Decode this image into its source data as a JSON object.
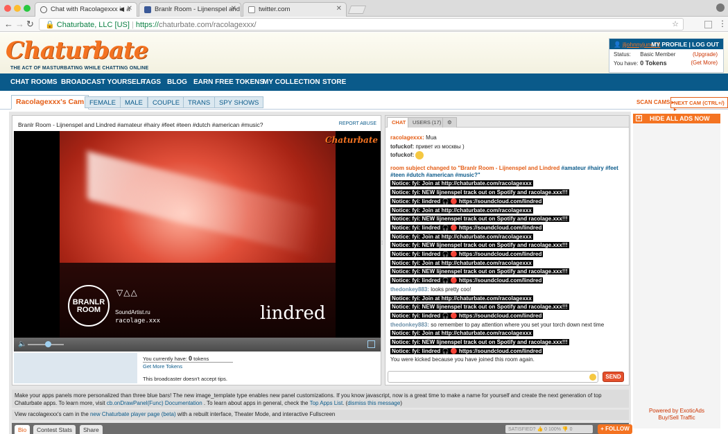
{
  "browser": {
    "tabs": [
      {
        "title": "Chat with Racolagexxx in a"
      },
      {
        "title": "Branlr Room - Lijnenspel and L"
      },
      {
        "title": "twitter.com"
      }
    ],
    "url_secure_label": "Chaturbate, LLC [US]",
    "url_https": "https://",
    "url_rest": "chaturbate.com/racolagexxx/"
  },
  "header": {
    "logo": "Chaturbate",
    "tagline": "THE ACT OF MASTURBATING WHILE CHATTING ONLINE",
    "user": {
      "username": "jljohnnyjune78",
      "my_profile": "MY PROFILE",
      "log_out": "LOG OUT",
      "status_label": "Status:",
      "status_value": "Basic Member",
      "upgrade": "(Upgrade)",
      "have_label": "You have:",
      "have_value": "0 Tokens",
      "get_more": "(Get More)"
    }
  },
  "nav": [
    "CHAT ROOMS",
    "BROADCAST YOURSELF",
    "TAGS",
    "BLOG",
    "EARN FREE TOKENS",
    "MY COLLECTION",
    "STORE"
  ],
  "subnav": {
    "tabs": [
      "Racolagexxx's Cam",
      "FEMALE",
      "MALE",
      "COUPLE",
      "TRANS",
      "SPY SHOWS"
    ],
    "scan_cams": "SCAN CAMS",
    "next_cam": "NEXT CAM (CTRL+/)"
  },
  "video": {
    "title": "Branlr Room - Lijnenspel and Lindred #amateur #hairy #feet #teen #dutch #american #music?",
    "report_abuse": "REPORT ABUSE",
    "watermark": "Chaturbate",
    "overlay_branlr": "BRANLR ROOM",
    "overlay_triangles": "▽△△",
    "overlay_soundartist": "SoundArtist.ru",
    "overlay_racolage": "racolage.xxx",
    "overlay_lindred": "lindred",
    "volume_level": 0.55
  },
  "tips": {
    "you_have_prefix": "You currently have:",
    "tokens_count": "0",
    "tokens_suffix": "tokens",
    "get_more_tokens": "Get More Tokens",
    "no_tips": "This broadcaster doesn't accept tips."
  },
  "chat": {
    "tabs": [
      "CHAT",
      "USERS (17)"
    ],
    "send": "SEND",
    "messages": [
      {
        "type": "user",
        "user": "racolagexxx:",
        "text": "Mua"
      },
      {
        "type": "user2",
        "user": "tofuckof:",
        "text": "привет из москвы )"
      },
      {
        "type": "user2emoji",
        "user": "tofuckof:",
        "text": ""
      },
      {
        "type": "subject",
        "text": "room subject changed to \"Branlr Room - Lijnenspel and Lindred",
        "tags": "#amateur #hairy #feet #teen #dutch #american #music?\""
      },
      {
        "type": "notice",
        "text": "Notice: fyi: Join at http://chaturbate.com/racolagexxx"
      },
      {
        "type": "notice",
        "text": "Notice: fyi: NEW lijnenspel track out on Spotify and racolage.xxx!!!"
      },
      {
        "type": "notice",
        "text": "Notice: fyi: lindred 🎧 🔴 https://soundcloud.com/lindred"
      },
      {
        "type": "notice",
        "text": "Notice: fyi: Join at http://chaturbate.com/racolagexxx"
      },
      {
        "type": "notice",
        "text": "Notice: fyi: NEW lijnenspel track out on Spotify and racolage.xxx!!!"
      },
      {
        "type": "notice",
        "text": "Notice: fyi: lindred 🎧 🔴 https://soundcloud.com/lindred"
      },
      {
        "type": "notice",
        "text": "Notice: fyi: Join at http://chaturbate.com/racolagexxx"
      },
      {
        "type": "notice",
        "text": "Notice: fyi: NEW lijnenspel track out on Spotify and racolage.xxx!!!"
      },
      {
        "type": "notice",
        "text": "Notice: fyi: lindred 🎧 🔴 https://soundcloud.com/lindred"
      },
      {
        "type": "notice",
        "text": "Notice: fyi: Join at http://chaturbate.com/racolagexxx"
      },
      {
        "type": "notice",
        "text": "Notice: fyi: NEW lijnenspel track out on Spotify and racolage.xxx!!!"
      },
      {
        "type": "notice",
        "text": "Notice: fyi: lindred 🎧 🔴 https://soundcloud.com/lindred"
      },
      {
        "type": "user3",
        "user": "thedonkey883:",
        "text": "looks pretty coo!"
      },
      {
        "type": "notice",
        "text": "Notice: fyi: Join at http://chaturbate.com/racolagexxx"
      },
      {
        "type": "notice",
        "text": "Notice: fyi: NEW lijnenspel track out on Spotify and racolage.xxx!!!"
      },
      {
        "type": "notice",
        "text": "Notice: fyi: lindred 🎧 🔴 https://soundcloud.com/lindred"
      },
      {
        "type": "user3",
        "user": "thedonkey883:",
        "text": "so remember to pay attention where you set your torch down next time"
      },
      {
        "type": "notice",
        "text": "Notice: fyi: Join at http://chaturbate.com/racolagexxx"
      },
      {
        "type": "notice",
        "text": "Notice: fyi: NEW lijnenspel track out on Spotify and racolage.xxx!!!"
      },
      {
        "type": "notice",
        "text": "Notice: fyi: lindred 🎧 🔴 https://soundcloud.com/lindred"
      },
      {
        "type": "plain",
        "text": "You were kicked because you have joined this room again."
      }
    ]
  },
  "infobar": {
    "text1": "Make your apps panels more personalized than three blue bars! The new image_template type enables new panel customizations. If you know javascript, now is a great time to make a name for yourself and create the next generation of top Chaturbate apps. To learn more, visit ",
    "link1": "cb.onDrawPanel(Func) Documentation",
    "text2": " . To learn about apps in general, check the ",
    "link2": "Top Apps List",
    "text3": ". (",
    "link3": "dismiss this message",
    "text4": ")"
  },
  "viewbar": {
    "prefix": "View racolagexxx's cam in the ",
    "link": "new Chaturbate player page (beta)",
    "suffix": " with a rebuilt interface, Theater Mode, and interactive Fullscreen"
  },
  "bottom": {
    "tabs": [
      "Bio",
      "Contest Stats",
      "Share"
    ],
    "satisfied": "SATISFIED?",
    "satisfied_count": "0",
    "satisfied_pct": "100%",
    "unsatisfied_count": "0",
    "follow": "+ FOLLOW"
  },
  "ads": {
    "hide": "HIDE ALL ADS NOW",
    "powered": "Powered by ExoticAds",
    "buysell": "Buy/Sell Traffic"
  }
}
